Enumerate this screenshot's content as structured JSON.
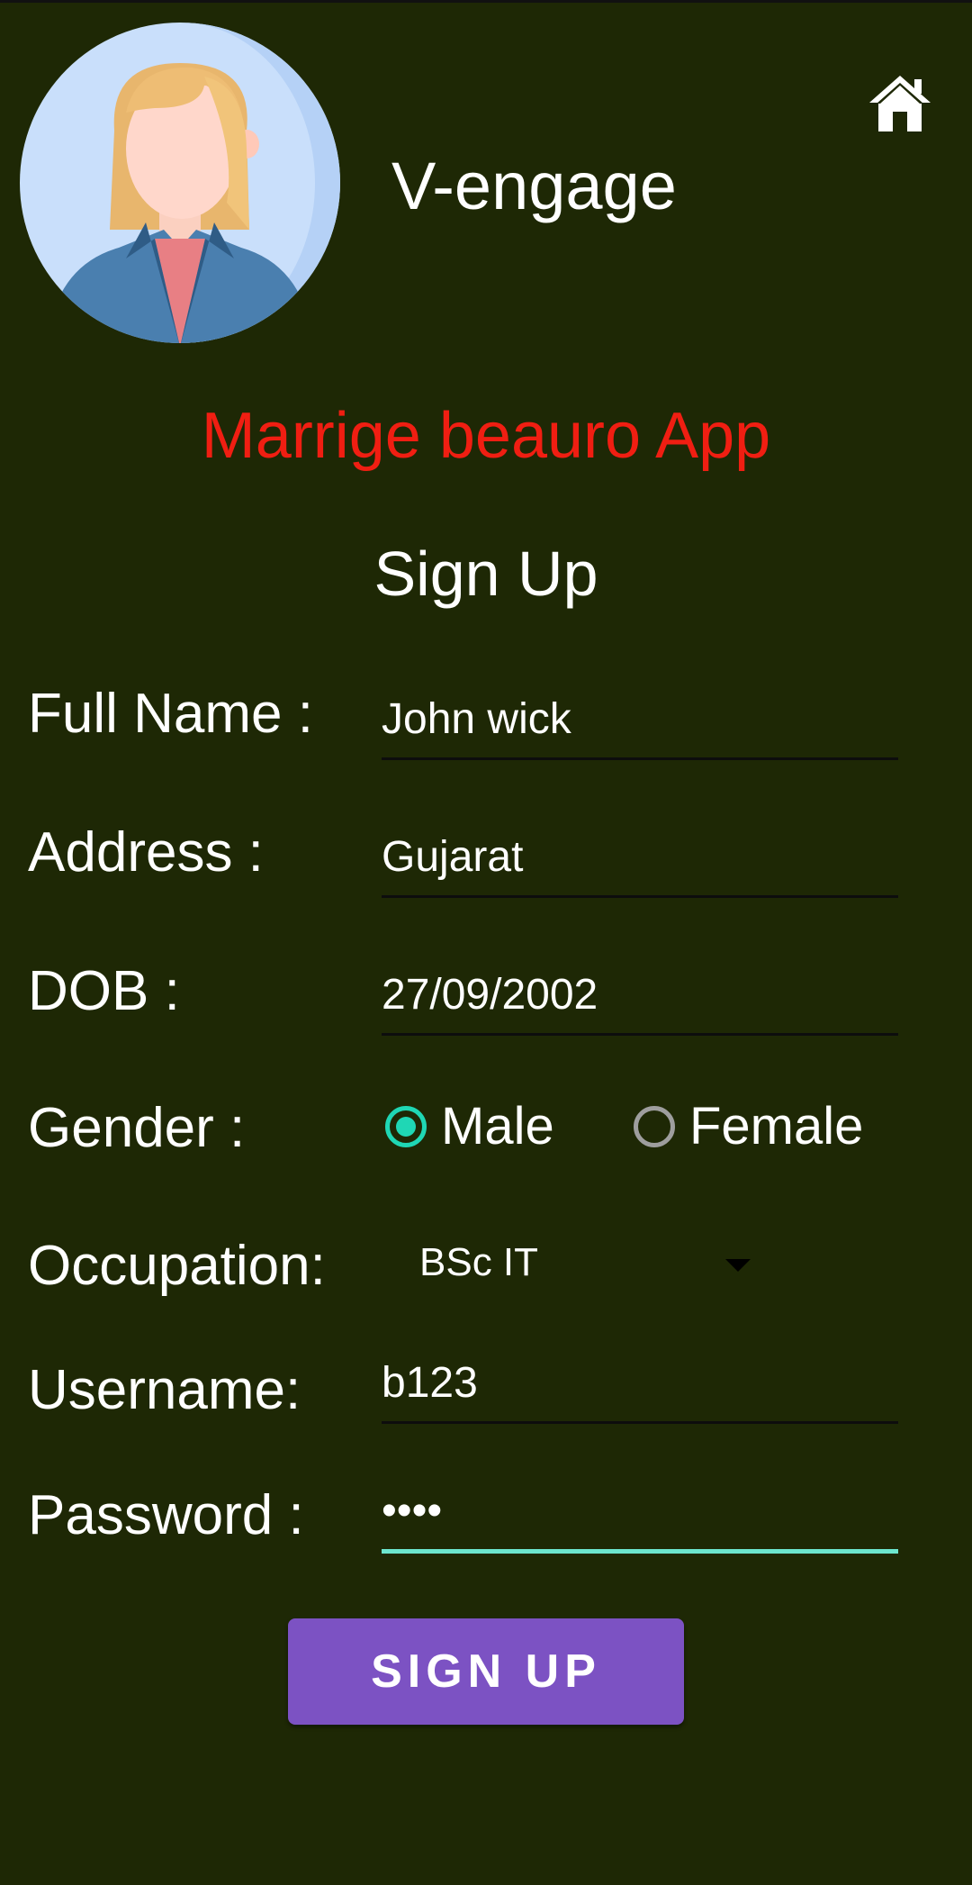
{
  "header": {
    "app_name": "V-engage",
    "subtitle": "Marrige beauro App"
  },
  "form": {
    "heading": "Sign Up",
    "full_name": {
      "label": "Full Name :",
      "value": "John wick"
    },
    "address": {
      "label": "Address :",
      "value": "Gujarat"
    },
    "dob": {
      "label": "DOB :",
      "value": "27/09/2002"
    },
    "gender": {
      "label": "Gender :",
      "options": [
        "Male",
        "Female"
      ],
      "selected": "Male"
    },
    "occupation": {
      "label": "Occupation:",
      "selected": "BSc IT"
    },
    "username": {
      "label": "Username:",
      "value": "b123"
    },
    "password": {
      "label": "Password :",
      "value": "••••"
    },
    "submit_label": "SIGN UP"
  },
  "colors": {
    "background": "#1e2805",
    "subtitle": "#f01e12",
    "accent": "#1fd7b5",
    "button": "#7c52c3"
  },
  "icons": [
    "avatar-icon",
    "home-icon",
    "dropdown-arrow-icon"
  ]
}
